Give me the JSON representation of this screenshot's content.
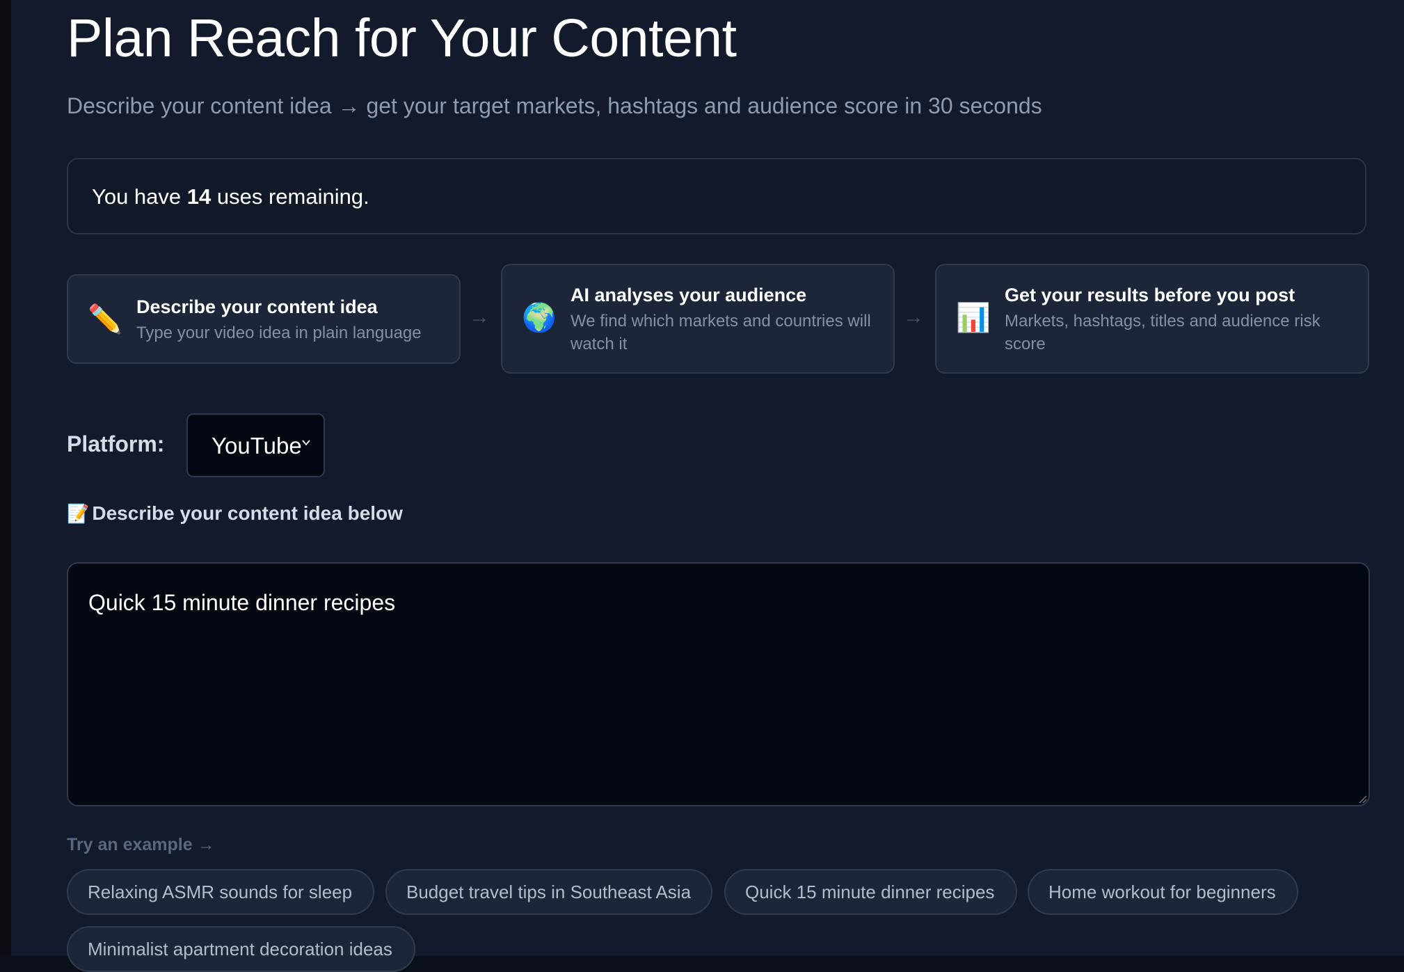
{
  "header": {
    "title": "Plan Reach for Your Content",
    "subtitle": "Describe your content idea → get your target markets, hashtags and audience score in 30 seconds"
  },
  "usage": {
    "prefix": "You have ",
    "count": "14",
    "suffix": " uses remaining."
  },
  "steps": [
    {
      "icon": "pencil-icon",
      "glyph": "✏️",
      "title": "Describe your content idea",
      "description": "Type your video idea in plain language"
    },
    {
      "icon": "globe-icon",
      "glyph": "🌍",
      "title": "AI analyses your audience",
      "description": "We find which markets and countries will watch it"
    },
    {
      "icon": "bar-chart-icon",
      "glyph": "📊",
      "title": "Get your results before you post",
      "description": "Markets, hashtags, titles and audience risk score"
    }
  ],
  "step_arrow": "→",
  "platform": {
    "label": "Platform:",
    "selected": "YouTube"
  },
  "idea": {
    "label_icon": "📝",
    "label": "Describe your content idea below",
    "value": "Quick 15 minute dinner recipes"
  },
  "examples": {
    "label": "Try an example →",
    "chips": [
      "Relaxing ASMR sounds for sleep",
      "Budget travel tips in Southeast Asia",
      "Quick 15 minute dinner recipes",
      "Home workout for beginners",
      "Minimalist apartment decoration ideas"
    ]
  },
  "colors": {
    "background": "#121a2b",
    "card": "#1d2638",
    "input_bg": "#030712",
    "border": "#2f3a4f",
    "muted_text": "#8f9bb0"
  }
}
